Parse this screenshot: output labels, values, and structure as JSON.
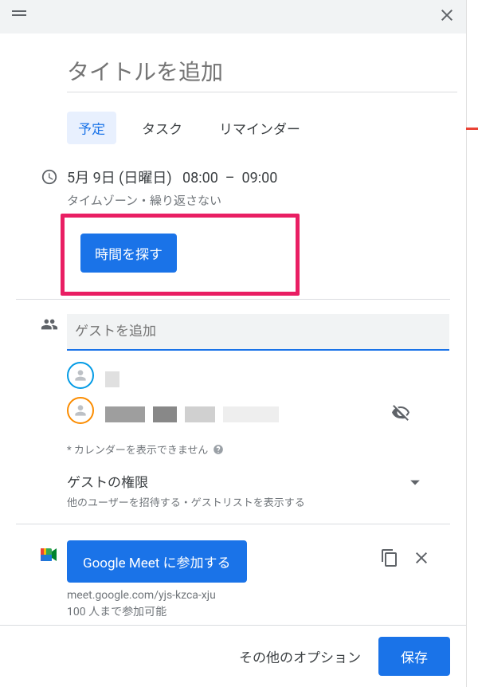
{
  "title_placeholder": "タイトルを追加",
  "tabs": {
    "event": "予定",
    "task": "タスク",
    "reminder": "リマインダー"
  },
  "datetime": {
    "date": "5月 9日 (日曜日)",
    "start": "08:00",
    "dash": "–",
    "end": "09:00",
    "tz": "タイムゾーン・繰り返さない"
  },
  "find_time": "時間を探す",
  "guest_placeholder": "ゲストを追加",
  "calendar_warning": "* カレンダーを表示できません",
  "permissions": {
    "title": "ゲストの権限",
    "subtitle": "他のユーザーを招待する・ゲストリストを表示する"
  },
  "meet": {
    "button": "Google Meet に参加する",
    "link": "meet.google.com/yjs-kzca-xju",
    "capacity": "100 人まで参加可能"
  },
  "footer": {
    "more": "その他のオプション",
    "save": "保存"
  }
}
